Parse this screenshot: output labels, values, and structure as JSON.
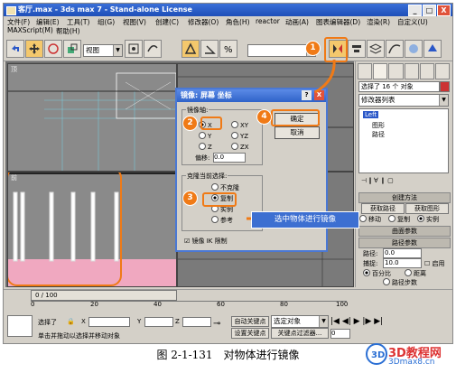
{
  "window": {
    "title": "客厅.max - 3ds max 7 - Stand-alone License",
    "min": "_",
    "max": "□",
    "close": "X"
  },
  "menu": {
    "items": [
      "文件(F)",
      "编辑(E)",
      "工具(T)",
      "组(G)",
      "视图(V)",
      "创建(C)",
      "修改器(O)",
      "角色(H)",
      "reactor",
      "动画(A)",
      "图表编辑器(D)",
      "渲染(R)",
      "自定义(U)"
    ],
    "row2": [
      "MAXScript(M)",
      "帮助(H)"
    ]
  },
  "toolbar": {
    "view_combo": "视图"
  },
  "viewports": {
    "tl_label": "顶",
    "bl_label": "前",
    "br_label": "左"
  },
  "command_panel": {
    "selection_text": "选择了 16 个 对象",
    "modifier_list": "修改器列表",
    "stack": [
      "Left",
      "图形",
      "路径"
    ],
    "rollouts": {
      "create_method": "创建方法",
      "get_path": "获取路径",
      "get_shape": "获取图形",
      "move": "移动",
      "copy": "复制",
      "instance": "实例",
      "surface_params": "曲面参数",
      "path_params": "路径参数",
      "path_label": "路径:",
      "path_value": "0.0",
      "snap_label": "捕捉:",
      "snap_value": "10.0",
      "enable": "启用",
      "percent": "百分比",
      "distance": "距离",
      "path_steps": "路径步数"
    }
  },
  "dialog": {
    "title": "镜像: 屏幕 坐标",
    "help": "?",
    "close": "X",
    "axis_group": "镜像轴:",
    "axes": [
      "X",
      "Y",
      "Z",
      "XY",
      "YZ",
      "ZX"
    ],
    "offset_label": "偏移:",
    "offset_value": "0.0",
    "clone_group": "克隆当前选择:",
    "clone_options": [
      "不克隆",
      "复制",
      "实例",
      "参考"
    ],
    "ok": "确定",
    "cancel": "取消",
    "ik_limit": "镜像 IK 限制"
  },
  "annotations": {
    "badges": [
      "1",
      "2",
      "3",
      "4"
    ],
    "callout": "选中物体进行镜像"
  },
  "status": {
    "frame": "0 / 100",
    "ticks": [
      "0",
      "20",
      "40",
      "60",
      "80",
      "100"
    ],
    "selected_text": "选择了",
    "x_label": "X",
    "y_label": "Y",
    "z_label": "Z",
    "auto_key": "自动关键点",
    "set_key": "设置关键点",
    "key_filters": "关键点过滤器...",
    "select_object": "选定对象",
    "hint": "单击并拖动以选择并移动对象",
    "frame_field": "0"
  },
  "caption": "图 2-1-131　对物体进行镜像",
  "watermark": {
    "brand": "3D教程网",
    "site": "3Dmax8.cn"
  },
  "colors": {
    "accent": "#f07a16",
    "title": "#2f63c9",
    "callout": "#3d6fd1"
  }
}
